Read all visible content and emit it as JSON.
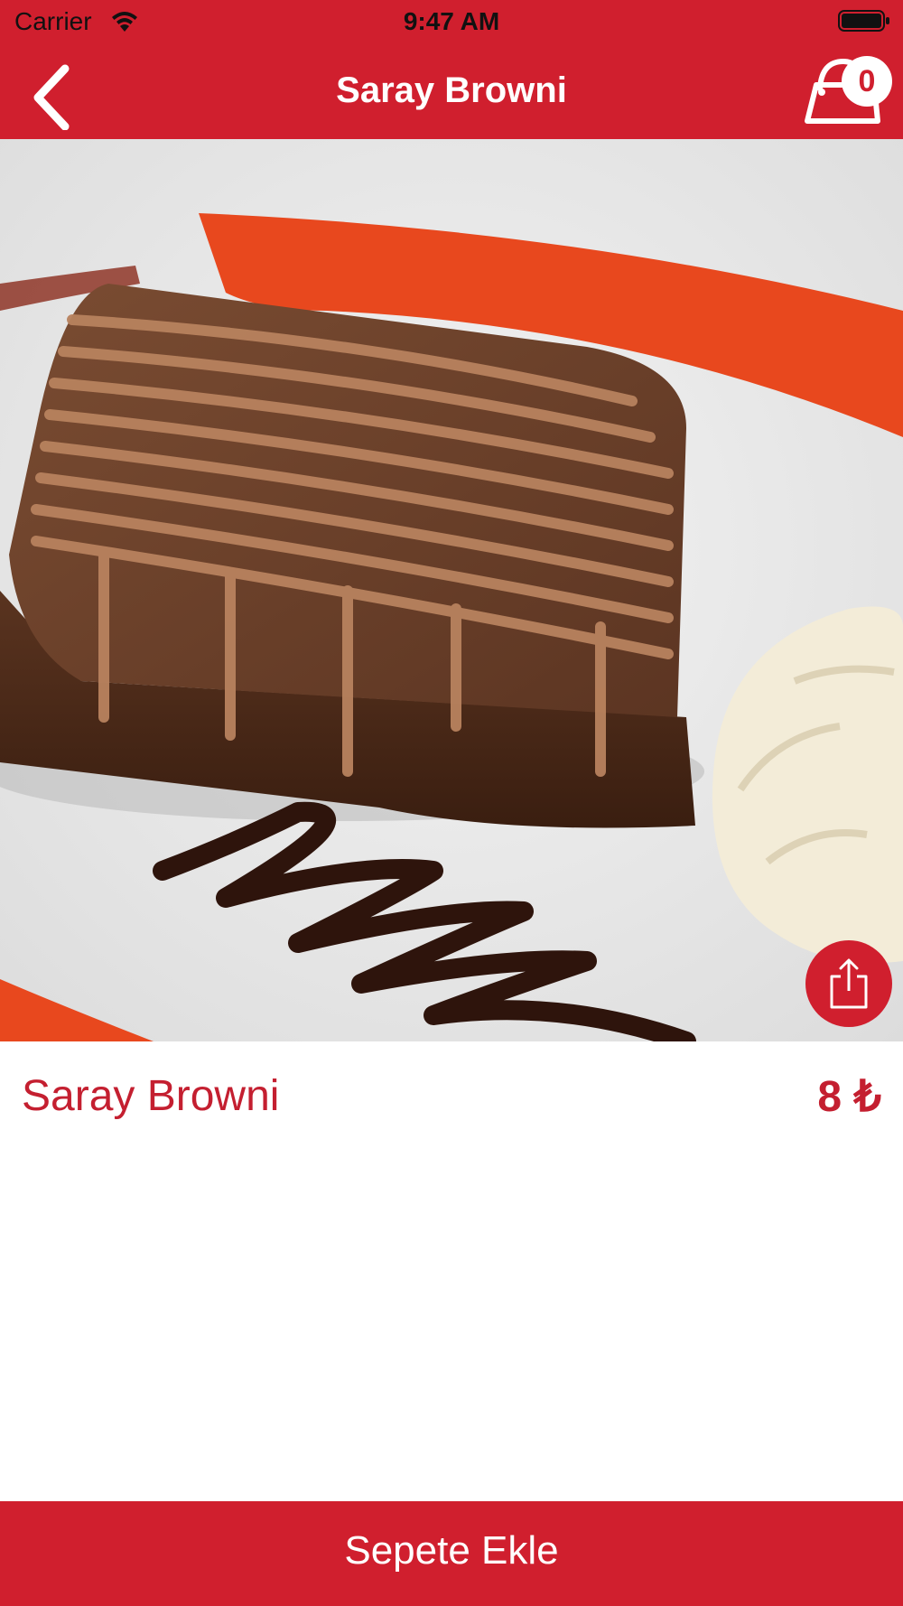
{
  "status_bar": {
    "carrier": "Carrier",
    "time": "9:47 AM"
  },
  "nav": {
    "title": "Saray Browni",
    "cart_count": "0"
  },
  "product": {
    "name": "Saray Browni",
    "price": "8 ₺",
    "image": "brownie-with-chocolate-drizzle-and-ice-cream"
  },
  "actions": {
    "add_to_cart_label": "Sepete Ekle"
  },
  "icons": {
    "back": "chevron-left-icon",
    "cart": "shopping-bag-icon",
    "share": "share-icon"
  },
  "colors": {
    "brand": "#d01f2e",
    "text_accent": "#c41f30",
    "background": "#ffffff"
  }
}
